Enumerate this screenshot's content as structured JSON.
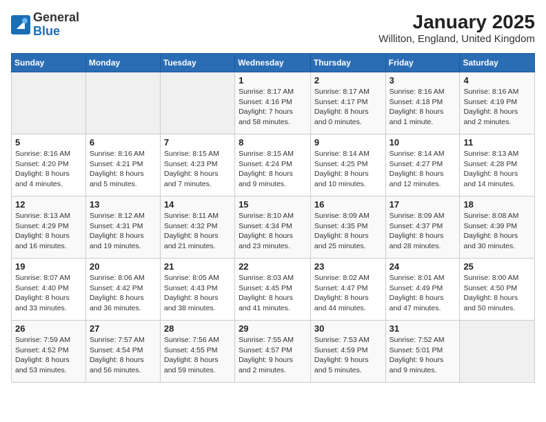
{
  "logo": {
    "general": "General",
    "blue": "Blue"
  },
  "title": "January 2025",
  "subtitle": "Williton, England, United Kingdom",
  "days_of_week": [
    "Sunday",
    "Monday",
    "Tuesday",
    "Wednesday",
    "Thursday",
    "Friday",
    "Saturday"
  ],
  "weeks": [
    [
      {
        "day": "",
        "info": ""
      },
      {
        "day": "",
        "info": ""
      },
      {
        "day": "",
        "info": ""
      },
      {
        "day": "1",
        "info": "Sunrise: 8:17 AM\nSunset: 4:16 PM\nDaylight: 7 hours\nand 58 minutes."
      },
      {
        "day": "2",
        "info": "Sunrise: 8:17 AM\nSunset: 4:17 PM\nDaylight: 8 hours\nand 0 minutes."
      },
      {
        "day": "3",
        "info": "Sunrise: 8:16 AM\nSunset: 4:18 PM\nDaylight: 8 hours\nand 1 minute."
      },
      {
        "day": "4",
        "info": "Sunrise: 8:16 AM\nSunset: 4:19 PM\nDaylight: 8 hours\nand 2 minutes."
      }
    ],
    [
      {
        "day": "5",
        "info": "Sunrise: 8:16 AM\nSunset: 4:20 PM\nDaylight: 8 hours\nand 4 minutes."
      },
      {
        "day": "6",
        "info": "Sunrise: 8:16 AM\nSunset: 4:21 PM\nDaylight: 8 hours\nand 5 minutes."
      },
      {
        "day": "7",
        "info": "Sunrise: 8:15 AM\nSunset: 4:23 PM\nDaylight: 8 hours\nand 7 minutes."
      },
      {
        "day": "8",
        "info": "Sunrise: 8:15 AM\nSunset: 4:24 PM\nDaylight: 8 hours\nand 9 minutes."
      },
      {
        "day": "9",
        "info": "Sunrise: 8:14 AM\nSunset: 4:25 PM\nDaylight: 8 hours\nand 10 minutes."
      },
      {
        "day": "10",
        "info": "Sunrise: 8:14 AM\nSunset: 4:27 PM\nDaylight: 8 hours\nand 12 minutes."
      },
      {
        "day": "11",
        "info": "Sunrise: 8:13 AM\nSunset: 4:28 PM\nDaylight: 8 hours\nand 14 minutes."
      }
    ],
    [
      {
        "day": "12",
        "info": "Sunrise: 8:13 AM\nSunset: 4:29 PM\nDaylight: 8 hours\nand 16 minutes."
      },
      {
        "day": "13",
        "info": "Sunrise: 8:12 AM\nSunset: 4:31 PM\nDaylight: 8 hours\nand 19 minutes."
      },
      {
        "day": "14",
        "info": "Sunrise: 8:11 AM\nSunset: 4:32 PM\nDaylight: 8 hours\nand 21 minutes."
      },
      {
        "day": "15",
        "info": "Sunrise: 8:10 AM\nSunset: 4:34 PM\nDaylight: 8 hours\nand 23 minutes."
      },
      {
        "day": "16",
        "info": "Sunrise: 8:09 AM\nSunset: 4:35 PM\nDaylight: 8 hours\nand 25 minutes."
      },
      {
        "day": "17",
        "info": "Sunrise: 8:09 AM\nSunset: 4:37 PM\nDaylight: 8 hours\nand 28 minutes."
      },
      {
        "day": "18",
        "info": "Sunrise: 8:08 AM\nSunset: 4:39 PM\nDaylight: 8 hours\nand 30 minutes."
      }
    ],
    [
      {
        "day": "19",
        "info": "Sunrise: 8:07 AM\nSunset: 4:40 PM\nDaylight: 8 hours\nand 33 minutes."
      },
      {
        "day": "20",
        "info": "Sunrise: 8:06 AM\nSunset: 4:42 PM\nDaylight: 8 hours\nand 36 minutes."
      },
      {
        "day": "21",
        "info": "Sunrise: 8:05 AM\nSunset: 4:43 PM\nDaylight: 8 hours\nand 38 minutes."
      },
      {
        "day": "22",
        "info": "Sunrise: 8:03 AM\nSunset: 4:45 PM\nDaylight: 8 hours\nand 41 minutes."
      },
      {
        "day": "23",
        "info": "Sunrise: 8:02 AM\nSunset: 4:47 PM\nDaylight: 8 hours\nand 44 minutes."
      },
      {
        "day": "24",
        "info": "Sunrise: 8:01 AM\nSunset: 4:49 PM\nDaylight: 8 hours\nand 47 minutes."
      },
      {
        "day": "25",
        "info": "Sunrise: 8:00 AM\nSunset: 4:50 PM\nDaylight: 8 hours\nand 50 minutes."
      }
    ],
    [
      {
        "day": "26",
        "info": "Sunrise: 7:59 AM\nSunset: 4:52 PM\nDaylight: 8 hours\nand 53 minutes."
      },
      {
        "day": "27",
        "info": "Sunrise: 7:57 AM\nSunset: 4:54 PM\nDaylight: 8 hours\nand 56 minutes."
      },
      {
        "day": "28",
        "info": "Sunrise: 7:56 AM\nSunset: 4:55 PM\nDaylight: 8 hours\nand 59 minutes."
      },
      {
        "day": "29",
        "info": "Sunrise: 7:55 AM\nSunset: 4:57 PM\nDaylight: 9 hours\nand 2 minutes."
      },
      {
        "day": "30",
        "info": "Sunrise: 7:53 AM\nSunset: 4:59 PM\nDaylight: 9 hours\nand 5 minutes."
      },
      {
        "day": "31",
        "info": "Sunrise: 7:52 AM\nSunset: 5:01 PM\nDaylight: 9 hours\nand 9 minutes."
      },
      {
        "day": "",
        "info": ""
      }
    ]
  ]
}
